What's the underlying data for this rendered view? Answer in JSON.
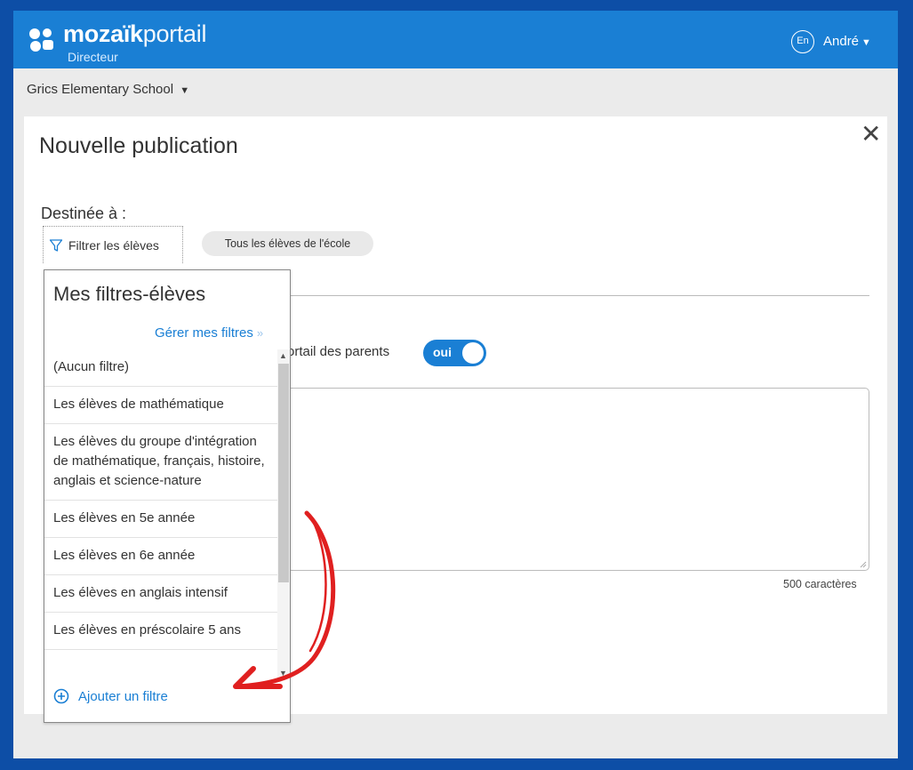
{
  "header": {
    "brand_bold": "mozaïk",
    "brand_light": "portail",
    "role": "Directeur",
    "lang": "En",
    "user": "André",
    "caret": "▼"
  },
  "school": {
    "name": "Grics Elementary School",
    "caret": "▼"
  },
  "publication": {
    "title": "Nouvelle publication",
    "close_label": "✕",
    "destination_label": "Destinée à :",
    "filter_button": "Filtrer les élèves",
    "audience_chip": "Tous les élèves de l'école",
    "portal_label": "ortail des parents",
    "toggle_label": "oui",
    "char_count": "500 caractères"
  },
  "filter_dropdown": {
    "title": "Mes filtres-élèves",
    "manage_link": "Gérer mes filtres",
    "manage_chevron": "»",
    "items": [
      "(Aucun filtre)",
      "Les élèves de mathématique",
      "Les élèves du groupe d'intégration de mathématique, français, histoire, anglais et science-nature",
      "Les élèves en 5e année",
      "Les élèves en 6e année",
      "Les élèves en anglais intensif",
      "Les élèves en préscolaire 5 ans"
    ],
    "add_filter": "Ajouter un filtre"
  },
  "colors": {
    "frame": "#0d4ea6",
    "topbar": "#1a7fd4",
    "link": "#1a7fd4",
    "annotation": "#e02020"
  }
}
